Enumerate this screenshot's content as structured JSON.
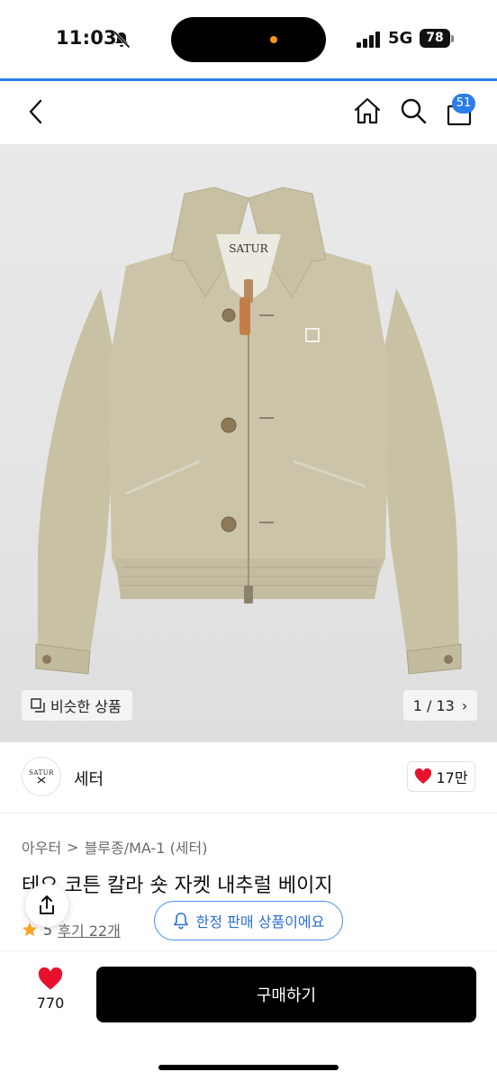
{
  "status_bar": {
    "time": "11:03",
    "network": "5G",
    "battery": "78",
    "icons": [
      "bell-muted-icon",
      "signal-icon",
      "battery-icon"
    ]
  },
  "nav": {
    "icons": [
      "back-icon",
      "home-icon",
      "search-icon",
      "bag-icon"
    ],
    "cart_count": "51"
  },
  "hero": {
    "logo_text": "SATUR",
    "similar_label": "비슷한 상품",
    "pager": "1 / 13",
    "pager_chevron": "›"
  },
  "brand": {
    "logo_text": "SATUR",
    "name": "세터",
    "likes": "17만"
  },
  "product": {
    "breadcrumb_first": "아우터",
    "breadcrumb_separator": ">",
    "breadcrumb_second": "블루종/MA-1 (세터)",
    "title": "테오 코튼 칼라 숏 자켓 내추럴 베이지",
    "rating": "5",
    "reviews": "후기 22개"
  },
  "limited_notice": "한정 판매 상품이에요",
  "bottom": {
    "wish_count": "770",
    "buy_label": "구매하기"
  },
  "colors": {
    "accent": "#2b7de9",
    "heart": "#e8112d",
    "star": "#f5a623",
    "jacket": "#c9c2a6"
  }
}
